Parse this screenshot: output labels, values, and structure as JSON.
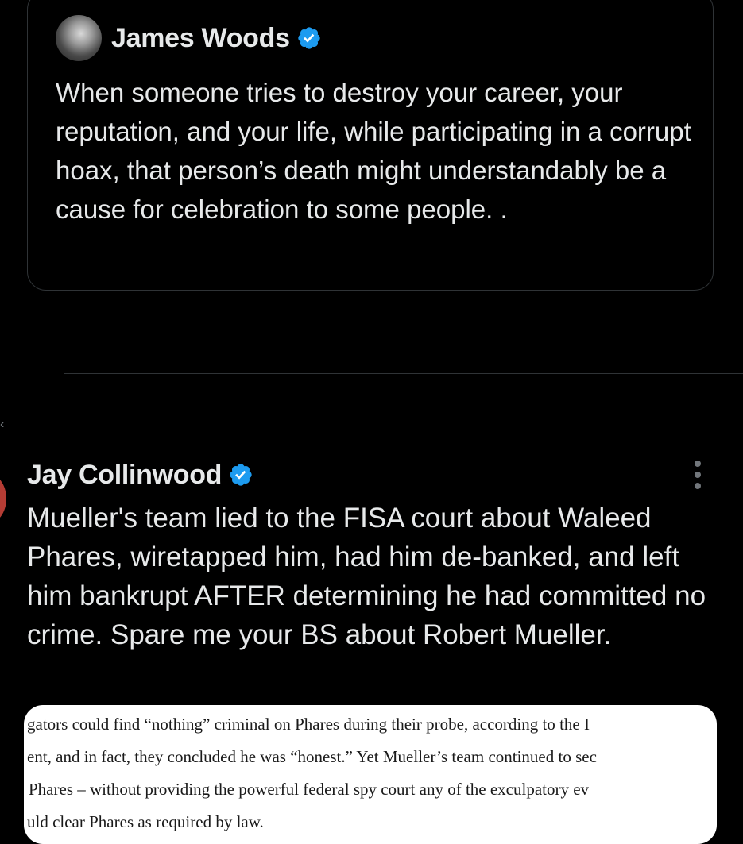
{
  "quoted_tweet": {
    "author_name": "James Woods",
    "verified_icon": "verified-badge-icon",
    "text": "When someone tries to destroy your career, your reputation, and your life, while participating in a corrupt hoax, that person’s death might understandably be a cause for celebration to some people. ."
  },
  "reply_tweet": {
    "author_name": "Jay Collinwood",
    "verified_icon": "verified-badge-icon",
    "more_icon": "more-options-icon",
    "text": "Mueller's team lied to the FISA court about Waleed Phares, wiretapped him, had him de-banked, and left him bankrupt AFTER determining he had committed no crime. Spare me your BS about Robert Mueller.",
    "attached_image_lines": [
      "gators could find “nothing” criminal on Phares during their probe, according to the I",
      "ent, and in fact, they concluded he was “honest.” Yet Mueller’s team continued to sec",
      "Phares – without providing the powerful federal spy court any of the exculpatory ev",
      "uld clear Phares as required by law."
    ]
  },
  "colors": {
    "background": "#000000",
    "text": "#e7e9ea",
    "verified_blue": "#1d9bf0",
    "muted": "#71767b",
    "border": "#2f3336"
  }
}
